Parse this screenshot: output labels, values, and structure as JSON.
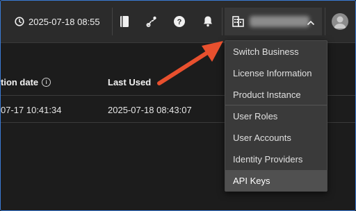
{
  "header": {
    "datetime": "2025-07-18 08:55",
    "icons": [
      "clock-icon",
      "book-icon",
      "route-icon",
      "help-icon",
      "bell-icon",
      "building-icon",
      "chevron-up-icon",
      "avatar-icon"
    ],
    "business_name": ""
  },
  "table": {
    "columns": [
      "tion date",
      "Last Used"
    ],
    "rows": [
      [
        "07-17 10:41:34",
        "2025-07-18 08:43:07"
      ]
    ]
  },
  "menu": {
    "items": [
      {
        "label": "Switch Business"
      },
      {
        "label": "License Information"
      },
      {
        "label": "Product Instance"
      },
      {
        "label": "User Roles"
      },
      {
        "label": "User Accounts"
      },
      {
        "label": "Identity Providers"
      },
      {
        "label": "API Keys"
      }
    ],
    "active_item": "API Keys"
  },
  "annotation": {
    "arrow_color": "#e8502e"
  }
}
